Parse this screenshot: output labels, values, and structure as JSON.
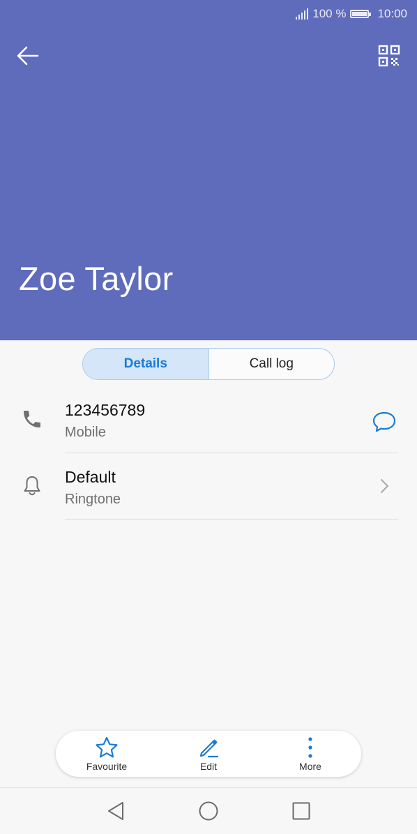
{
  "status_bar": {
    "battery_text": "100 %",
    "time": "10:00"
  },
  "header": {
    "contact_name": "Zoe Taylor",
    "background_color": "#5f6bbb",
    "back_icon": "arrow-left-icon",
    "qr_icon": "qr-code-icon"
  },
  "tabs": [
    {
      "label": "Details",
      "active": true
    },
    {
      "label": "Call log",
      "active": false
    }
  ],
  "details": {
    "phone": {
      "number": "123456789",
      "type": "Mobile",
      "icon": "phone-icon",
      "action_icon": "message-icon"
    },
    "ringtone": {
      "value": "Default",
      "label": "Ringtone",
      "icon": "bell-icon",
      "action_icon": "chevron-right-icon"
    }
  },
  "actions": [
    {
      "label": "Favourite",
      "icon": "star-icon"
    },
    {
      "label": "Edit",
      "icon": "pencil-icon"
    },
    {
      "label": "More",
      "icon": "more-vertical-icon"
    }
  ],
  "nav_bar": {
    "back": "back-triangle-icon",
    "home": "home-circle-icon",
    "recents": "recents-square-icon"
  },
  "colors": {
    "accent": "#1a7bd6",
    "tab_active_bg": "#d4e6f7"
  }
}
